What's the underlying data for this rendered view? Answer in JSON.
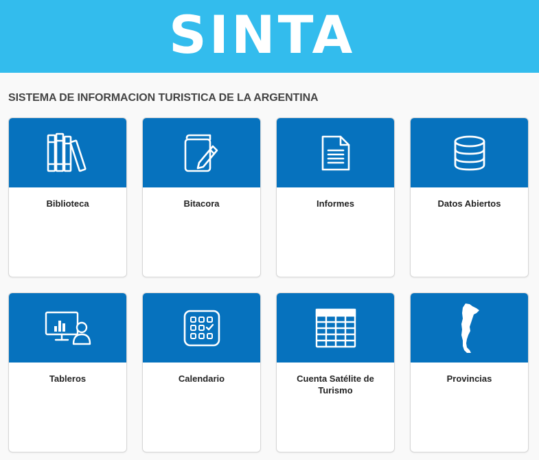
{
  "header": {
    "title": "SINTA"
  },
  "subtitle": "SISTEMA DE INFORMACION TURISTICA DE LA ARGENTINA",
  "cards": [
    {
      "label": "Biblioteca",
      "icon": "books-icon"
    },
    {
      "label": "Bitacora",
      "icon": "notebook-pen-icon"
    },
    {
      "label": "Informes",
      "icon": "document-icon"
    },
    {
      "label": "Datos Abiertos",
      "icon": "database-icon"
    },
    {
      "label": "Tableros",
      "icon": "dashboard-presenter-icon"
    },
    {
      "label": "Calendario",
      "icon": "calendar-icon"
    },
    {
      "label": "Cuenta Satélite de Turismo",
      "icon": "table-grid-icon"
    },
    {
      "label": "Provincias",
      "icon": "argentina-map-icon"
    }
  ],
  "colors": {
    "header_bg": "#33bced",
    "card_accent": "#0672be",
    "page_bg": "#f9f9f9"
  }
}
